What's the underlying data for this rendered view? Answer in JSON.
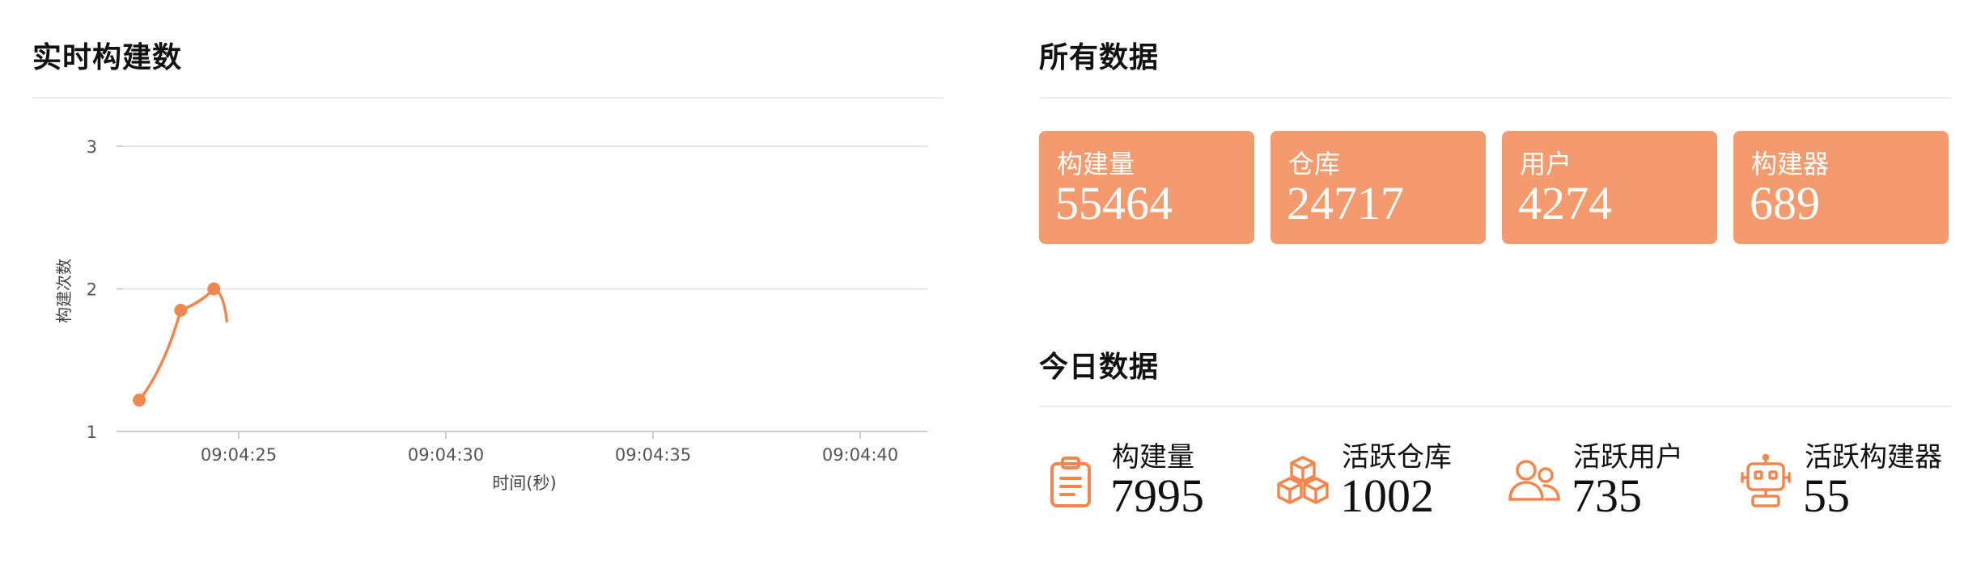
{
  "realtime": {
    "title": "实时构建数",
    "chart_data": {
      "type": "line",
      "title": "",
      "xlabel": "时间(秒)",
      "ylabel": "构建次数",
      "ylim": [
        1,
        3
      ],
      "yticks": [
        "1",
        "2",
        "3"
      ],
      "xticks": [
        "09:04:25",
        "09:04:30",
        "09:04:35",
        "09:04:40"
      ],
      "series": [
        {
          "color": "#f0874f",
          "points": [
            {
              "x": "09:04:22.6",
              "y": 1.22
            },
            {
              "x": "09:04:23.6",
              "y": 1.85
            },
            {
              "x": "09:04:24.4",
              "y": 2.0
            }
          ]
        }
      ],
      "grid": true
    }
  },
  "all_data": {
    "title": "所有数据",
    "cards": [
      {
        "label": "构建量",
        "value": "55464"
      },
      {
        "label": "仓库",
        "value": "24717"
      },
      {
        "label": "用户",
        "value": "4274"
      },
      {
        "label": "构建器",
        "value": "689"
      }
    ],
    "card_color": "#f39b6e"
  },
  "today": {
    "title": "今日数据",
    "items": [
      {
        "label": "构建量",
        "value": "7995",
        "icon": "clipboard-icon"
      },
      {
        "label": "活跃仓库",
        "value": "1002",
        "icon": "cubes-icon"
      },
      {
        "label": "活跃用户",
        "value": "735",
        "icon": "users-icon"
      },
      {
        "label": "活跃构建器",
        "value": "55",
        "icon": "robot-icon"
      }
    ],
    "icon_color": "#f0874f"
  }
}
